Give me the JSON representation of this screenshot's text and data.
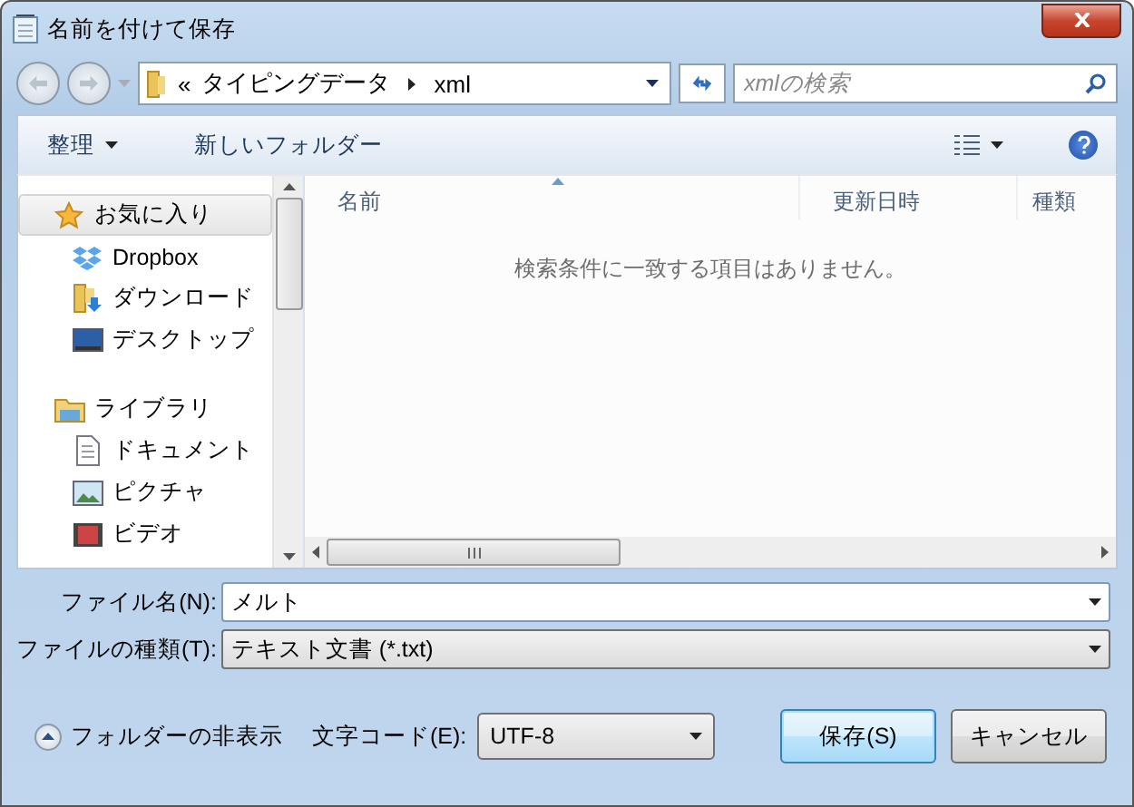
{
  "window": {
    "title": "名前を付けて保存"
  },
  "address": {
    "overflow": "«",
    "path": [
      "タイピングデータ",
      "xml"
    ]
  },
  "search": {
    "placeholder": "xmlの検索"
  },
  "toolbar": {
    "organize": "整理",
    "new_folder": "新しいフォルダー"
  },
  "nav": [
    {
      "label": "お気に入り",
      "kind": "favorites",
      "selected": true,
      "children": [
        {
          "label": "Dropbox",
          "kind": "dropbox",
          "selected": false
        },
        {
          "label": "ダウンロード",
          "kind": "downloads",
          "selected": false
        },
        {
          "label": "デスクトップ",
          "kind": "desktop",
          "selected": false
        }
      ]
    },
    {
      "label": "ライブラリ",
      "kind": "library",
      "selected": false,
      "children": [
        {
          "label": "ドキュメント",
          "kind": "document",
          "selected": false
        },
        {
          "label": "ピクチャ",
          "kind": "picture",
          "selected": false
        },
        {
          "label": "ビデオ",
          "kind": "video",
          "selected": false
        }
      ]
    }
  ],
  "columns": [
    {
      "label": "名前",
      "sorted": true
    },
    {
      "label": "更新日時",
      "sorted": false
    },
    {
      "label": "種類",
      "sorted": false
    }
  ],
  "empty_message": "検索条件に一致する項目はありません。",
  "fields": [
    {
      "label": "ファイル名(N):",
      "value": "メルト",
      "kind": "editable"
    },
    {
      "label": "ファイルの種類(T):",
      "value": "テキスト文書 (*.txt)",
      "kind": "select"
    }
  ],
  "hide_folders": "フォルダーの非表示",
  "encoding": {
    "label": "文字コード(E):",
    "value": "UTF-8"
  },
  "buttons": [
    {
      "label": "保存(S)",
      "default": true
    },
    {
      "label": "キャンセル",
      "default": false
    }
  ]
}
